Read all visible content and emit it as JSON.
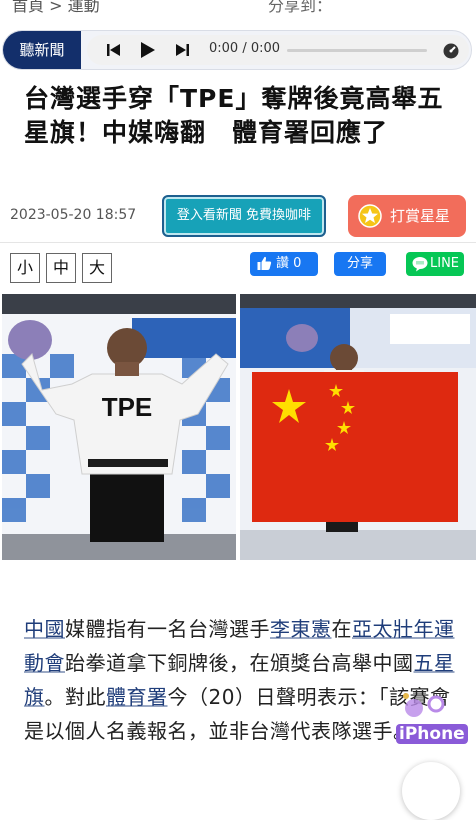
{
  "breadcrumb": {
    "text": "首頁 > 運動",
    "share_label": "分享到："
  },
  "audio": {
    "label": "聽新聞",
    "time": "0:00 / 0:00"
  },
  "article": {
    "title": "台灣選手穿「TPE」奪牌後竟高舉五星旗！中媒嗨翻　體育署回應了",
    "date": "2023-05-20 18:57",
    "promo_label": "登入看新聞 免費換咖啡",
    "tip_label": "打賞星星",
    "font_sizes": [
      "小",
      "中",
      "大"
    ],
    "like_label": "讚 0",
    "share_label": "分享",
    "line_label": "LINE 分享",
    "jersey_text": "TPE",
    "body": {
      "p1": "中國",
      "p2": "媒體指有一名台灣選手",
      "p3": "李東憲",
      "p4": "在",
      "p5": "亞太壯年運動會",
      "p6": "跆拳道拿下銅牌後，在頒獎台高舉中國",
      "p7": "五星旗",
      "p8": "。對此",
      "p9": "體育署",
      "p10": "今（20）日聲明表示：「該賽會是以個人名義報名，並非台灣代表隊選手。」"
    }
  },
  "watermark": {
    "text": "iPhone"
  },
  "colors": {
    "navy": "#132f6b",
    "promo": "#17a2b8",
    "tip": "#f26d5b",
    "facebook": "#1877f2",
    "line": "#06c755",
    "flag_red": "#de2910",
    "flag_star": "#ffde00"
  }
}
